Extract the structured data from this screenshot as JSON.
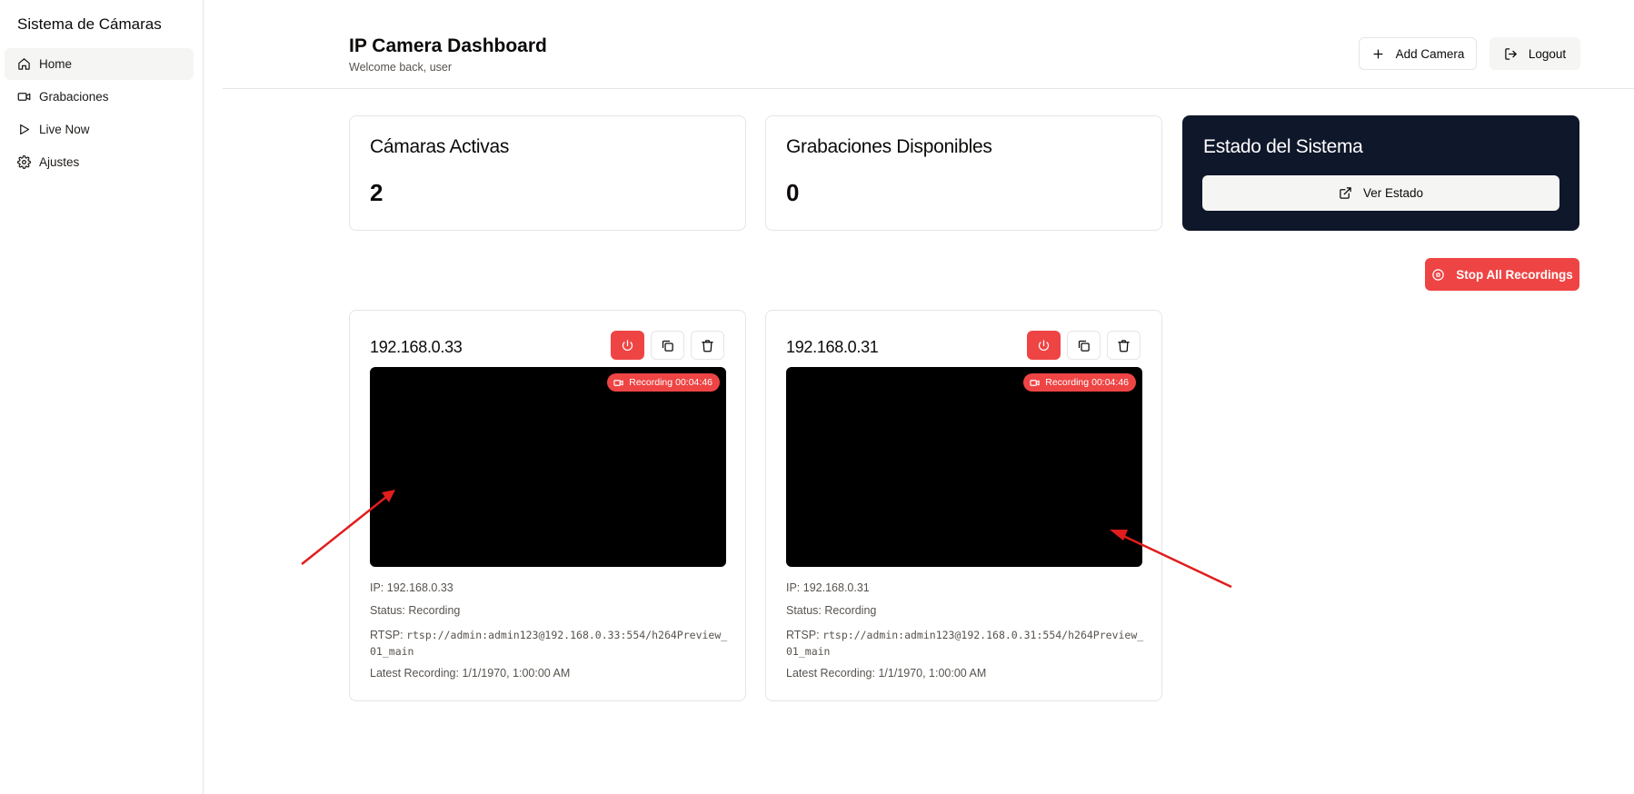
{
  "sidebar": {
    "brand": "Sistema de Cámaras",
    "items": [
      {
        "label": "Home",
        "icon": "home-icon",
        "active": true
      },
      {
        "label": "Grabaciones",
        "icon": "video-icon",
        "active": false
      },
      {
        "label": "Live Now",
        "icon": "play-icon",
        "active": false
      },
      {
        "label": "Ajustes",
        "icon": "gear-icon",
        "active": false
      }
    ]
  },
  "header": {
    "title": "IP Camera Dashboard",
    "subtitle": "Welcome back, user",
    "add_camera_label": "Add Camera",
    "logout_label": "Logout"
  },
  "stats": {
    "active_cameras": {
      "title": "Cámaras Activas",
      "value": "2"
    },
    "recordings": {
      "title": "Grabaciones Disponibles",
      "value": "0"
    },
    "system": {
      "title": "Estado del Sistema",
      "button_label": "Ver Estado"
    }
  },
  "stop_all_label": "Stop All Recordings",
  "cameras": [
    {
      "title": "192.168.0.33",
      "badge_label": "Recording",
      "badge_time": "00:04:46",
      "ip_line": "IP: 192.168.0.33",
      "status_line": "Status: Recording",
      "rtsp_label": "RTSP:",
      "rtsp_url": "rtsp://admin:admin123@192.168.0.33:554/h264Preview_01_main",
      "latest_line": "Latest Recording: 1/1/1970, 1:00:00 AM"
    },
    {
      "title": "192.168.0.31",
      "badge_label": "Recording",
      "badge_time": "00:04:46",
      "ip_line": "IP: 192.168.0.31",
      "status_line": "Status: Recording",
      "rtsp_label": "RTSP:",
      "rtsp_url": "rtsp://admin:admin123@192.168.0.31:554/h264Preview_01_main",
      "latest_line": "Latest Recording: 1/1/1970, 1:00:00 AM"
    }
  ],
  "colors": {
    "accent_red": "#ef4444",
    "dark_card": "#0f172a",
    "annotation_arrow": "#e11d1d"
  }
}
